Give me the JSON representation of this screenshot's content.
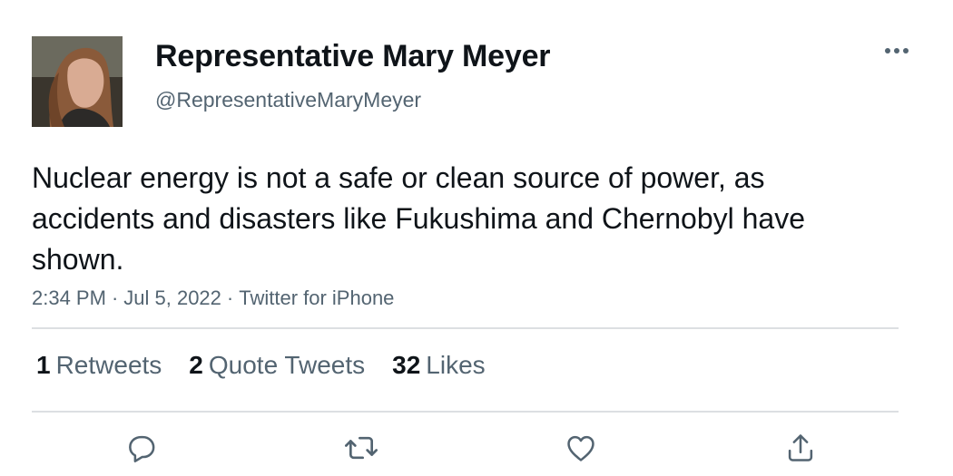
{
  "author": {
    "display_name": "Representative Mary Meyer",
    "handle": "@RepresentativeMaryMeyer",
    "avatar_icon": "profile-photo"
  },
  "tweet": {
    "text": "Nuclear energy is not a safe or clean source of power, as accidents and disasters like Fukushima and Chernobyl have shown.",
    "time": "2:34 PM",
    "date": "Jul 5, 2022",
    "source": "Twitter for iPhone",
    "separator": "·"
  },
  "stats": {
    "retweets_count": "1",
    "retweets_label": "Retweets",
    "quotes_count": "2",
    "quotes_label": "Quote Tweets",
    "likes_count": "32",
    "likes_label": "Likes"
  },
  "actions": [
    "reply-icon",
    "retweet-icon",
    "like-icon",
    "share-icon"
  ],
  "colors": {
    "text": "#0f1419",
    "secondary": "#536471",
    "divider": "#dcdfe2",
    "icon": "#536471"
  }
}
